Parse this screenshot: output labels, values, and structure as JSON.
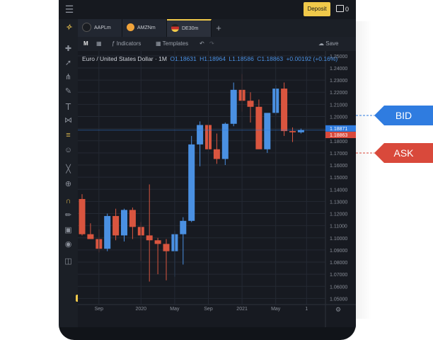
{
  "topbar": {
    "deposit_label": "Deposit",
    "balance": "0"
  },
  "tabs": [
    {
      "label": "AAPLm",
      "icon_color": "#1a1d22"
    },
    {
      "label": "AMZNm",
      "icon_color": "#f0a33a"
    },
    {
      "label": "DE30m",
      "icon_color": "#c8302b"
    }
  ],
  "toolbar": {
    "timeframe": "M",
    "indicators_label": "Indicators",
    "templates_label": "Templates",
    "save_label": "Save"
  },
  "legend": {
    "title": "Euro / United States Dollar · 1M",
    "o_label": "O",
    "o": "1.18631",
    "h_label": "H",
    "h": "1.18964",
    "l_label": "L",
    "l": "1.18586",
    "c_label": "C",
    "c": "1.18863",
    "change": "+0.00192 (+0.16%)"
  },
  "price_badges": {
    "bid": "1.18871",
    "ask": "1.18863"
  },
  "callouts": {
    "bid": "BID",
    "ask": "ASK"
  },
  "colors": {
    "up": "#4a90e2",
    "down": "#d9553f",
    "accent": "#f0c94a"
  },
  "chart_data": {
    "type": "candlestick",
    "x_ticks": [
      "Sep",
      "2020",
      "May",
      "Sep",
      "2021",
      "May",
      "1"
    ],
    "y_ticks": [
      "1.25000",
      "1.24000",
      "1.23000",
      "1.22000",
      "1.21000",
      "1.20000",
      "1.19000",
      "1.18000",
      "1.17000",
      "1.16000",
      "1.15000",
      "1.14000",
      "1.13000",
      "1.12000",
      "1.11000",
      "1.10000",
      "1.09000",
      "1.08000",
      "1.07000",
      "1.06000",
      "1.05000"
    ],
    "ylim": [
      1.045,
      1.254
    ],
    "candles": [
      {
        "o": 1.132,
        "h": 1.136,
        "l": 1.102,
        "c": 1.103
      },
      {
        "o": 1.103,
        "h": 1.112,
        "l": 1.099,
        "c": 1.099
      },
      {
        "o": 1.099,
        "h": 1.107,
        "l": 1.088,
        "c": 1.091
      },
      {
        "o": 1.091,
        "h": 1.12,
        "l": 1.089,
        "c": 1.118
      },
      {
        "o": 1.118,
        "h": 1.124,
        "l": 1.098,
        "c": 1.102
      },
      {
        "o": 1.102,
        "h": 1.124,
        "l": 1.097,
        "c": 1.123
      },
      {
        "o": 1.123,
        "h": 1.125,
        "l": 1.099,
        "c": 1.109
      },
      {
        "o": 1.109,
        "h": 1.113,
        "l": 1.081,
        "c": 1.102
      },
      {
        "o": 1.102,
        "h": 1.144,
        "l": 1.064,
        "c": 1.098
      },
      {
        "o": 1.098,
        "h": 1.1,
        "l": 1.07,
        "c": 1.095
      },
      {
        "o": 1.095,
        "h": 1.099,
        "l": 1.065,
        "c": 1.089
      },
      {
        "o": 1.089,
        "h": 1.106,
        "l": 1.068,
        "c": 1.103
      },
      {
        "o": 1.103,
        "h": 1.117,
        "l": 1.078,
        "c": 1.114
      },
      {
        "o": 1.114,
        "h": 1.184,
        "l": 1.113,
        "c": 1.177
      },
      {
        "o": 1.177,
        "h": 1.196,
        "l": 1.159,
        "c": 1.193
      },
      {
        "o": 1.193,
        "h": 1.201,
        "l": 1.168,
        "c": 1.173
      },
      {
        "o": 1.173,
        "h": 1.186,
        "l": 1.161,
        "c": 1.165
      },
      {
        "o": 1.165,
        "h": 1.195,
        "l": 1.16,
        "c": 1.194
      },
      {
        "o": 1.194,
        "h": 1.228,
        "l": 1.192,
        "c": 1.222
      },
      {
        "o": 1.222,
        "h": 1.235,
        "l": 1.204,
        "c": 1.213
      },
      {
        "o": 1.213,
        "h": 1.22,
        "l": 1.195,
        "c": 1.208
      },
      {
        "o": 1.208,
        "h": 1.214,
        "l": 1.176,
        "c": 1.173
      },
      {
        "o": 1.173,
        "h": 1.202,
        "l": 1.17,
        "c": 1.203
      },
      {
        "o": 1.203,
        "h": 1.226,
        "l": 1.201,
        "c": 1.223
      },
      {
        "o": 1.223,
        "h": 1.228,
        "l": 1.184,
        "c": 1.188
      },
      {
        "o": 1.188,
        "h": 1.191,
        "l": 1.179,
        "c": 1.187
      },
      {
        "o": 1.187,
        "h": 1.19,
        "l": 1.186,
        "c": 1.189
      }
    ]
  }
}
